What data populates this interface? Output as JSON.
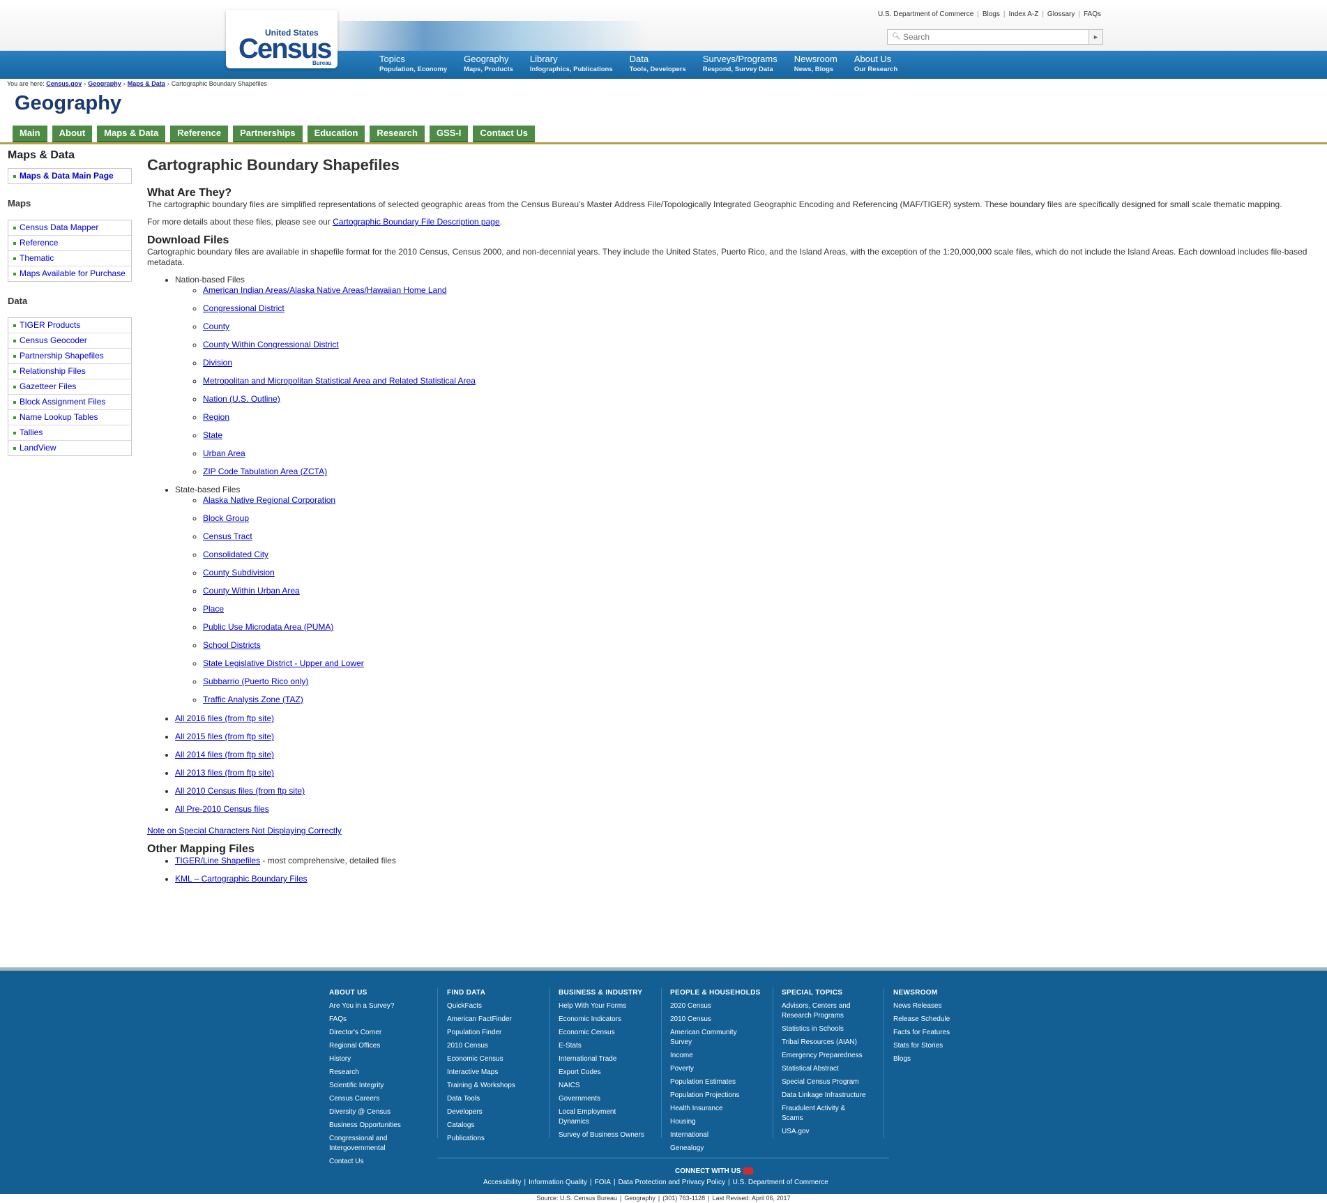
{
  "header": {
    "logo": {
      "line1": "United States",
      "line2": "Census",
      "line3": "Bureau"
    },
    "util_links": [
      "U.S. Department of Commerce",
      "Blogs",
      "Index A-Z",
      "Glossary",
      "FAQs"
    ],
    "search": {
      "placeholder": "Search"
    },
    "nav": [
      {
        "title": "Topics",
        "sub": "Population, Economy"
      },
      {
        "title": "Geography",
        "sub": "Maps, Products"
      },
      {
        "title": "Library",
        "sub": "Infographics, Publications"
      },
      {
        "title": "Data",
        "sub": "Tools, Developers"
      },
      {
        "title": "Surveys/Programs",
        "sub": "Respond, Survey Data"
      },
      {
        "title": "Newsroom",
        "sub": "News, Blogs"
      },
      {
        "title": "About Us",
        "sub": "Our Research"
      }
    ]
  },
  "breadcrumb": {
    "prefix": "You are here:",
    "links": [
      "Census.gov",
      "Geography",
      "Maps & Data"
    ],
    "current": "Cartographic Boundary Shapefiles"
  },
  "site_title": "Geography",
  "section_nav": [
    "Main",
    "About",
    "Maps & Data",
    "Reference",
    "Partnerships",
    "Education",
    "Research",
    "GSS-I",
    "Contact Us"
  ],
  "sidebar": {
    "heading": "Maps & Data",
    "main_link": "Maps & Data Main Page",
    "maps_heading": "Maps",
    "maps_items": [
      "Census Data Mapper",
      "Reference",
      "Thematic",
      "Maps Available for Purchase"
    ],
    "data_heading": "Data",
    "data_items": [
      "TIGER Products",
      "Census Geocoder",
      "Partnership Shapefiles",
      "Relationship Files",
      "Gazetteer Files",
      "Block Assignment Files",
      "Name Lookup Tables",
      "Tallies",
      "LandView"
    ]
  },
  "main": {
    "title": "Cartographic Boundary Shapefiles",
    "what_title": "What Are They?",
    "what_text": "The cartographic boundary files are simplified representations of selected geographic areas from the Census Bureau's Master Address File/Topologically Integrated Geographic Encoding and Referencing (MAF/TIGER) system.   These boundary files are specifically designed for small scale thematic mapping.",
    "details_prefix": "For more details about these files, please see our ",
    "details_link": "Cartographic Boundary File Description page",
    "details_suffix": ".",
    "download_title": "Download Files",
    "download_text": "Cartographic boundary files are available in shapefile format for the 2010 Census, Census 2000, and non-decennial years.  They include the United States, Puerto Rico, and the Island Areas, with the exception of the 1:20,000,000 scale files, which do not include the Island Areas. Each download includes file-based metadata.",
    "nation_label": "Nation-based Files",
    "nation_files": [
      "American Indian Areas/Alaska Native Areas/Hawaiian Home Land",
      "Congressional District",
      "County",
      "County Within Congressional District",
      "Division",
      "Metropolitan and Micropolitan Statistical Area and Related Statistical Area",
      "Nation (U.S. Outline)",
      "Region",
      "State",
      "Urban Area",
      "ZIP Code Tabulation Area (ZCTA)"
    ],
    "state_label": "State-based Files",
    "state_files": [
      "Alaska Native Regional Corporation",
      "Block Group",
      "Census Tract",
      "Consolidated City",
      "County Subdivision",
      "County Within Urban Area",
      "Place",
      "Public Use Microdata Area (PUMA)",
      "School Districts",
      "State Legislative District - Upper and Lower",
      "Subbarrio (Puerto Rico only)",
      "Traffic Analysis Zone (TAZ)"
    ],
    "all_files": [
      "All 2016 files (from ftp site)",
      "All 2015 files (from ftp site)",
      "All 2014 files (from ftp site)",
      "All 2013 files (from ftp site)",
      "All 2010 Census files (from ftp site)",
      "All Pre-2010 Census files"
    ],
    "special_chars_link": "Note on Special Characters Not Displaying Correctly",
    "other_title": "Other Mapping Files",
    "other_1_link": "TIGER/Line Shapefiles",
    "other_1_suffix": " - most comprehensive, detailed files",
    "other_2_link": "KML – Cartographic Boundary Files"
  },
  "footer": {
    "columns": [
      {
        "title": "ABOUT US",
        "links": [
          "Are You in a Survey?",
          "FAQs",
          "Director's Corner",
          "Regional Offices",
          "History",
          "Research",
          "Scientific Integrity",
          "Census Careers",
          "Diversity @ Census",
          "Business Opportunities",
          "Congressional and Intergovernmental",
          "Contact Us"
        ]
      },
      {
        "title": "FIND DATA",
        "links": [
          "QuickFacts",
          "American FactFinder",
          "Population Finder",
          "2010 Census",
          "Economic Census",
          "Interactive Maps",
          "Training & Workshops",
          "Data Tools",
          "Developers",
          "Catalogs",
          "Publications"
        ]
      },
      {
        "title": "BUSINESS & INDUSTRY",
        "links": [
          "Help With Your Forms",
          "Economic Indicators",
          "Economic Census",
          "E-Stats",
          "International Trade",
          "Export Codes",
          "NAICS",
          "Governments",
          "Local Employment Dynamics",
          "Survey of Business Owners"
        ]
      },
      {
        "title": "PEOPLE & HOUSEHOLDS",
        "links": [
          "2020 Census",
          "2010 Census",
          "American Community Survey",
          "Income",
          "Poverty",
          "Population Estimates",
          "Population Projections",
          "Health Insurance",
          "Housing",
          "International",
          "Genealogy"
        ]
      },
      {
        "title": "SPECIAL TOPICS",
        "links": [
          "Advisors, Centers and Research Programs",
          "Statistics in Schools",
          "Tribal Resources (AIAN)",
          "Emergency Preparedness",
          "Statistical Abstract",
          "Special Census Program",
          "Data Linkage Infrastructure",
          "Fraudulent Activity & Scams",
          "USA.gov"
        ]
      },
      {
        "title": "NEWSROOM",
        "links": [
          "News Releases",
          "Release Schedule",
          "Facts for Features",
          "Stats for Stories",
          "Blogs"
        ]
      }
    ],
    "connect": "CONNECT WITH US",
    "bottom_links": [
      "Accessibility",
      "Information Quality",
      "FOIA",
      "Data Protection and Privacy Policy",
      "U.S. Department of Commerce"
    ],
    "source_parts": [
      "Source: U.S. Census Bureau",
      "Geography",
      "(301) 763-1128",
      "Last Revised: April 06, 2017"
    ]
  }
}
